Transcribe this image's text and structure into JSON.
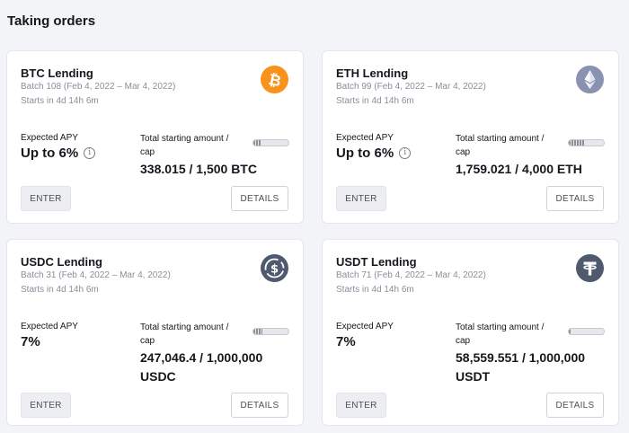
{
  "section_title": "Taking orders",
  "apy_label": "Expected APY",
  "cap_label": "Total starting amount / cap",
  "enter_label": "ENTER",
  "details_label": "DETAILS",
  "info_glyph": "i",
  "cards": [
    {
      "title": "BTC Lending",
      "batch": "Batch 108 (Feb 4, 2022 – Mar 4, 2022)",
      "starts": "Starts in 4d 14h 6m",
      "apy": "Up to 6%",
      "apy_info": true,
      "cap_value": "338.015 / 1,500 BTC",
      "cap_fill": 0.225,
      "icon": "bitcoin-icon",
      "icon_color": "#f7931a"
    },
    {
      "title": "ETH Lending",
      "batch": "Batch 99 (Feb 4, 2022 – Mar 4, 2022)",
      "starts": "Starts in 4d 14h 6m",
      "apy": "Up to 6%",
      "apy_info": true,
      "cap_value": "1,759.021 / 4,000 ETH",
      "cap_fill": 0.44,
      "icon": "ethereum-icon",
      "icon_color": "#8a92b2"
    },
    {
      "title": "USDC Lending",
      "batch": "Batch 31 (Feb 4, 2022 – Mar 4, 2022)",
      "starts": "Starts in 4d 14h 6m",
      "apy": "7%",
      "apy_info": false,
      "cap_value": "247,046.4 / 1,000,000 USDC",
      "cap_fill": 0.247,
      "icon": "usdc-icon",
      "icon_color": "#4f5a6e"
    },
    {
      "title": "USDT Lending",
      "batch": "Batch 71 (Feb 4, 2022 – Mar 4, 2022)",
      "starts": "Starts in 4d 14h 6m",
      "apy": "7%",
      "apy_info": false,
      "cap_value": "58,559.551 / 1,000,000 USDT",
      "cap_fill": 0.059,
      "icon": "tether-icon",
      "icon_color": "#4f5a6e"
    }
  ]
}
